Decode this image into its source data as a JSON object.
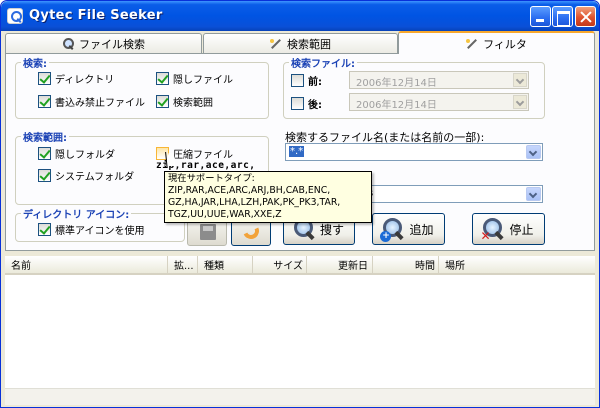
{
  "window": {
    "title": "Qytec  File Seeker"
  },
  "tabs": [
    {
      "label": "ファイル検索",
      "icon": "search-icon"
    },
    {
      "label": "検索範囲",
      "icon": "wand-icon"
    },
    {
      "label": "フィルタ",
      "icon": "wand-icon",
      "active": true
    }
  ],
  "search_group": {
    "legend": "検索:",
    "options": [
      {
        "label": "ディレクトリ",
        "checked": true
      },
      {
        "label": "隠しファイル",
        "checked": true
      },
      {
        "label": "書込み禁止ファイル",
        "checked": true
      },
      {
        "label": "検索範囲",
        "checked": true
      }
    ]
  },
  "range_group": {
    "legend": "検索範囲:",
    "options": [
      {
        "label": "隠しフォルダ",
        "checked": true
      },
      {
        "label": "圧縮ファイル",
        "checked": false
      },
      {
        "label": "システムフォルダ",
        "checked": true
      }
    ],
    "archive_exts_partial": "zip,rar,ace,arc,"
  },
  "icon_group": {
    "legend": "ディレクトリ アイコン:",
    "option": {
      "label": "標準アイコンを使用",
      "checked": true
    }
  },
  "file_date_group": {
    "legend": "検索ファイル:",
    "before": {
      "label": "前:",
      "value": "2006年12月14日",
      "checked": false
    },
    "after": {
      "label": "後:",
      "value": "2006年12月14日",
      "checked": false
    }
  },
  "filename": {
    "label": "検索するファイル名(または名前の一部):",
    "value": "*.*",
    "second_visible": "s"
  },
  "buttons": {
    "search": "捜す",
    "add": "追加",
    "stop": "停止"
  },
  "tooltip": {
    "title": "現在サポートタイプ:",
    "line1": "ZIP,RAR,ACE,ARC,ARJ,BH,CAB,ENC,",
    "line2": "GZ,HA,JAR,LHA,LZH,PAK,PK_PK3,TAR,",
    "line3": "TGZ,UU,UUE,WAR,XXE,Z"
  },
  "columns": [
    "名前",
    "拡...",
    "種類",
    "サイズ",
    "更新日",
    "時間",
    "場所"
  ]
}
